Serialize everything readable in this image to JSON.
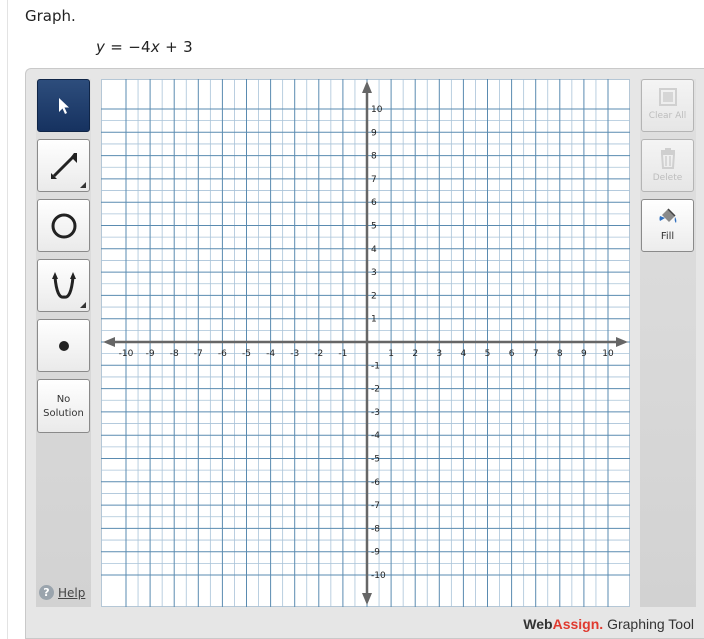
{
  "prompt": "Graph.",
  "equation": {
    "y": "y",
    "rhs_prefix": " = −4",
    "x": "x",
    "rhs_suffix": " + 3"
  },
  "tools": {
    "select": "select-pointer",
    "line": "line-ray",
    "circle": "circle",
    "parabola": "parabola",
    "point": "point",
    "no_solution_line1": "No",
    "no_solution_line2": "Solution"
  },
  "help_label": "Help",
  "side": {
    "clear_all": "Clear All",
    "delete": "Delete",
    "fill": "Fill"
  },
  "graph": {
    "x_min": -10,
    "x_max": 10,
    "y_min": -10,
    "y_max": 10,
    "x_ticks": [
      "-10",
      "-9",
      "-8",
      "-7",
      "-6",
      "-5",
      "-4",
      "-3",
      "-2",
      "-1",
      "1",
      "2",
      "3",
      "4",
      "5",
      "6",
      "7",
      "8",
      "9",
      "10"
    ],
    "y_ticks": [
      "10",
      "9",
      "8",
      "7",
      "6",
      "5",
      "4",
      "3",
      "2",
      "1",
      "-1",
      "-2",
      "-3",
      "-4",
      "-5",
      "-6",
      "-7",
      "-8",
      "-9",
      "-10"
    ],
    "minor_divisions": 2,
    "major_color": "#5a8bb0",
    "minor_color": "#a9c3d8",
    "axis_color": "#666666"
  },
  "brand": {
    "web": "Web",
    "assign": "Assign.",
    "rest": " Graphing Tool"
  }
}
